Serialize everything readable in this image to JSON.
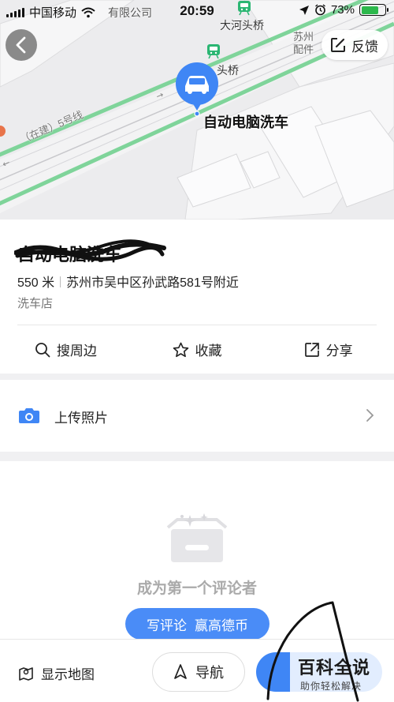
{
  "status_bar": {
    "carrier": "中国移动",
    "time": "20:59",
    "battery_percent": "73%",
    "battery_level": 0.73,
    "battery_color": "#2db84c"
  },
  "map": {
    "back_icon": "back-arrow-icon",
    "feedback_label": "反馈",
    "feedback_icon": "edit-square-icon",
    "labels": {
      "top_partial": "有限公司",
      "station_1": "大河头桥",
      "station_2": "头桥",
      "business_partial_1": "苏州",
      "business_partial_2": "配件",
      "line": "（在建）5号线",
      "poi": "自动电脑洗车"
    },
    "pin_color": "#3f86f5",
    "line_color": "#7fd49a"
  },
  "poi": {
    "title": "自动电脑洗车",
    "distance": "550 米",
    "address": "苏州市吴中区孙武路581号附近",
    "category": "洗车店"
  },
  "actions": [
    {
      "label": "搜周边",
      "icon": "search-icon"
    },
    {
      "label": "收藏",
      "icon": "star-icon"
    },
    {
      "label": "分享",
      "icon": "share-icon"
    }
  ],
  "upload": {
    "label": "上传照片",
    "icon": "camera-icon"
  },
  "reviews": {
    "empty_text": "成为第一个评论者",
    "write_label": "写评论",
    "reward_label": "赢高德币",
    "accent": "#4a8cf7"
  },
  "bottom_bar": {
    "show_map_label": "显示地图",
    "nav_label": "导航"
  },
  "watermark": {
    "title": "百科全说",
    "subtitle": "助你轻松解决"
  }
}
